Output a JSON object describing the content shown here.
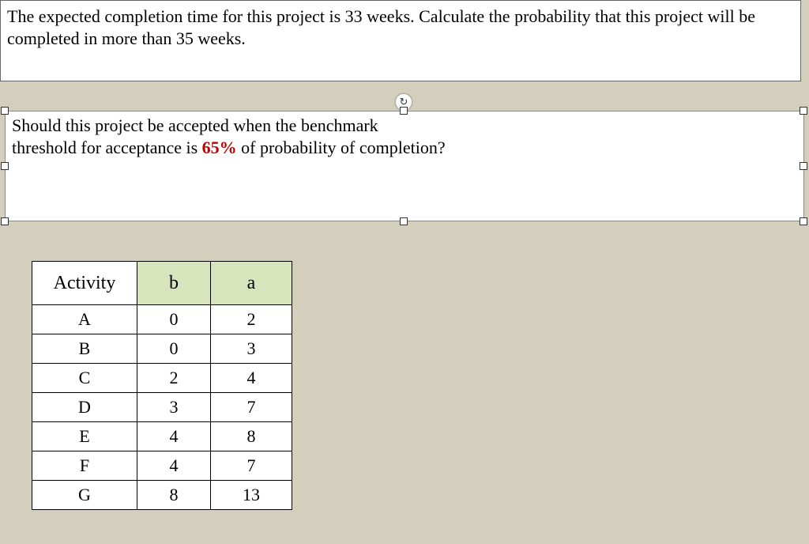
{
  "box1": {
    "text": "The expected completion time for this project is 33 weeks. Calculate the probability that this project will be completed in more than 35 weeks."
  },
  "box2": {
    "line1": "Should this project be accepted when the benchmark",
    "line2_pre": "threshold for acceptance is ",
    "line2_red": "65%",
    "line2_post": " of probability of completion?"
  },
  "refresh_glyph": "↻",
  "table": {
    "headers": {
      "activity": "Activity",
      "b": "b",
      "a": "a"
    },
    "rows": [
      {
        "activity": "A",
        "b": "0",
        "a": "2"
      },
      {
        "activity": "B",
        "b": "0",
        "a": "3"
      },
      {
        "activity": "C",
        "b": "2",
        "a": "4"
      },
      {
        "activity": "D",
        "b": "3",
        "a": "7"
      },
      {
        "activity": "E",
        "b": "4",
        "a": "8"
      },
      {
        "activity": "F",
        "b": "4",
        "a": "7"
      },
      {
        "activity": "G",
        "b": "8",
        "a": "13"
      }
    ]
  }
}
